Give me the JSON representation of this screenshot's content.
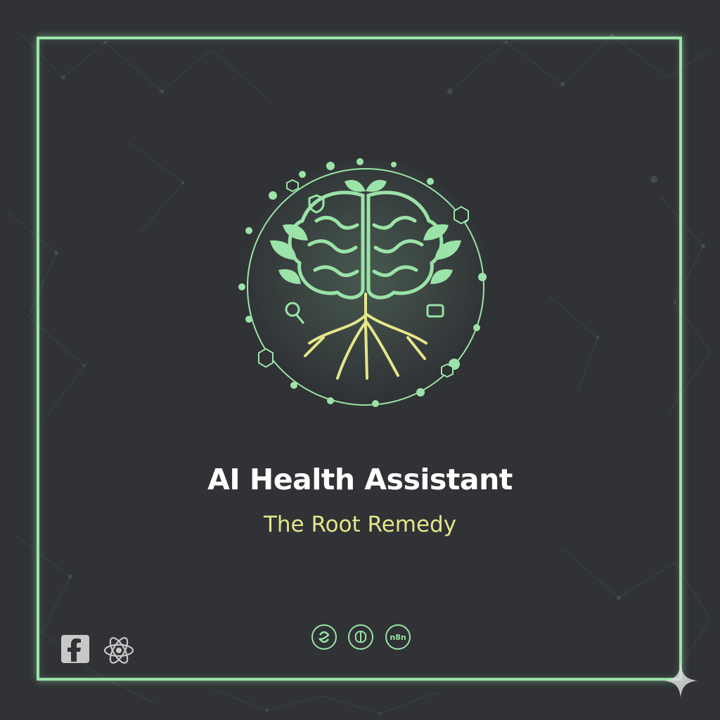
{
  "title": "AI Health Assistant",
  "subtitle": "The Root Remedy",
  "badges": [
    {
      "icon": "python-icon",
      "text": ""
    },
    {
      "icon": "brain-icon",
      "text": ""
    },
    {
      "icon": "n8n-icon",
      "text": "n8n"
    }
  ],
  "footer_icons": [
    "facebook-icon",
    "atom-icon"
  ],
  "colors": {
    "background": "#303236",
    "frame": "#9be3a8",
    "accent_green": "#9be3a8",
    "roots": "#e4e68a",
    "title": "#ffffff",
    "subtitle": "#e4e68a"
  }
}
